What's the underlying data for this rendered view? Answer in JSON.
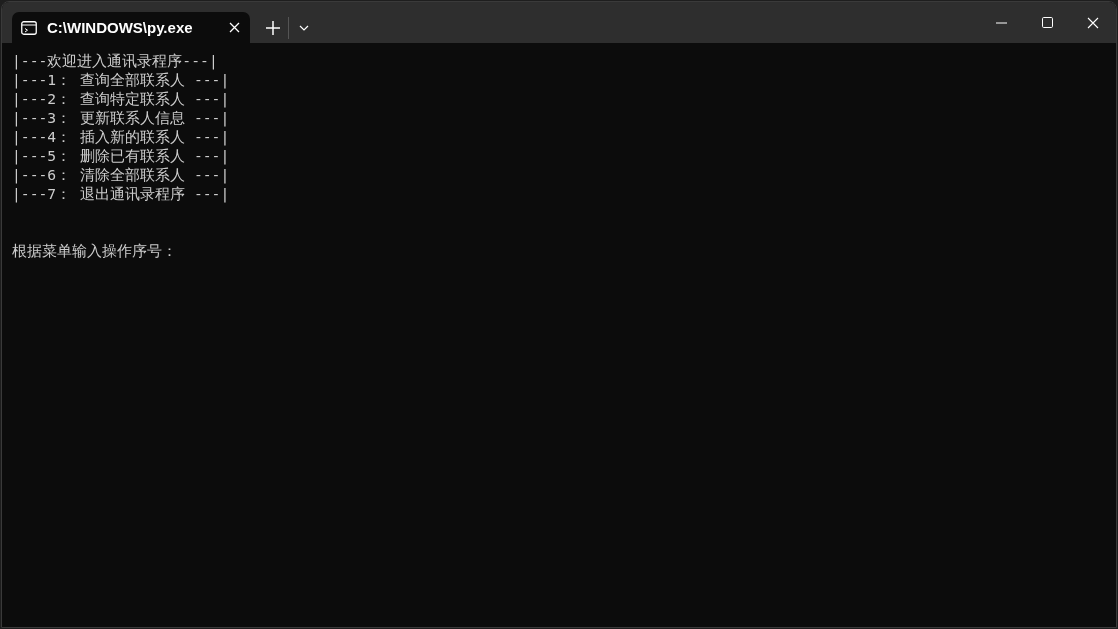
{
  "tab": {
    "title": "C:\\WINDOWS\\py.exe"
  },
  "terminal": {
    "lines": [
      "|---欢迎进入通讯录程序---|",
      "|---1： 查询全部联系人 ---|",
      "|---2： 查询特定联系人 ---|",
      "|---3： 更新联系人信息 ---|",
      "|---4： 插入新的联系人 ---|",
      "|---5： 删除已有联系人 ---|",
      "|---6： 清除全部联系人 ---|",
      "|---7： 退出通讯录程序 ---|"
    ],
    "prompt": "根据菜单输入操作序号："
  }
}
